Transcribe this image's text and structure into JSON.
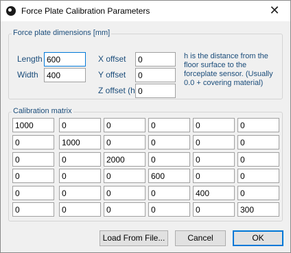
{
  "window": {
    "title": "Force Plate Calibration Parameters",
    "icon": "app-icon",
    "close_glyph": "✕"
  },
  "dimensions": {
    "legend": "Force plate dimensions [mm]",
    "length_label": "Length",
    "length_value": "600",
    "width_label": "Width",
    "width_value": "400",
    "x_offset_label": "X offset",
    "x_offset_value": "0",
    "y_offset_label": "Y offset",
    "y_offset_value": "0",
    "z_offset_label": "Z offset (h)",
    "z_offset_value": "0",
    "note": "h is the distance from the floor surface to the forceplate sensor. (Usually 0.0 + covering material)"
  },
  "matrix": {
    "legend": "Calibration matrix",
    "rows": [
      [
        "1000",
        "0",
        "0",
        "0",
        "0",
        "0"
      ],
      [
        "0",
        "1000",
        "0",
        "0",
        "0",
        "0"
      ],
      [
        "0",
        "0",
        "2000",
        "0",
        "0",
        "0"
      ],
      [
        "0",
        "0",
        "0",
        "600",
        "0",
        "0"
      ],
      [
        "0",
        "0",
        "0",
        "0",
        "400",
        "0"
      ],
      [
        "0",
        "0",
        "0",
        "0",
        "0",
        "300"
      ]
    ]
  },
  "buttons": {
    "load": "Load From File...",
    "cancel": "Cancel",
    "ok": "OK"
  },
  "colors": {
    "label_blue": "#1a4c7a",
    "focus_blue": "#0078d7"
  }
}
